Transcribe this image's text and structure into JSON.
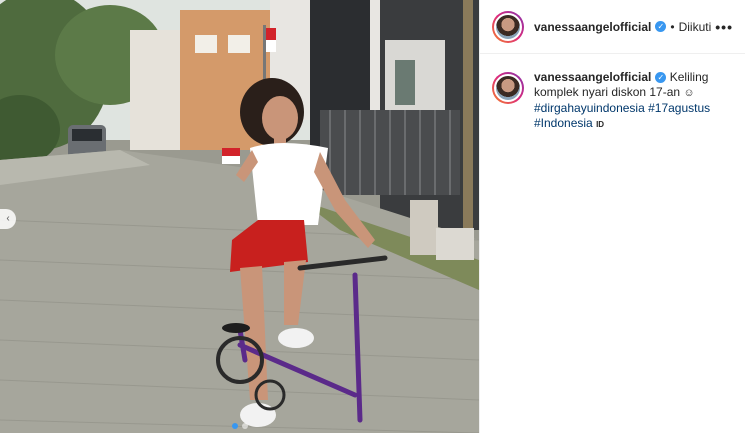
{
  "post": {
    "username": "vanessaangelofficial",
    "verified_icon": "verified-badge-icon",
    "separator": "•",
    "follow_status": "Diikuti",
    "more_icon": "•••",
    "caption": {
      "username": "vanessaangelofficial",
      "text": "Keliling komplek nyari diskon 17-an",
      "emoji": "☺",
      "hashtags": [
        "#dirgahayuindonesia",
        "#17agustus",
        "#Indonesia"
      ],
      "flag_text": "ID"
    }
  },
  "carousel": {
    "prev_icon": "‹",
    "slides": 2,
    "active_index": 0
  }
}
